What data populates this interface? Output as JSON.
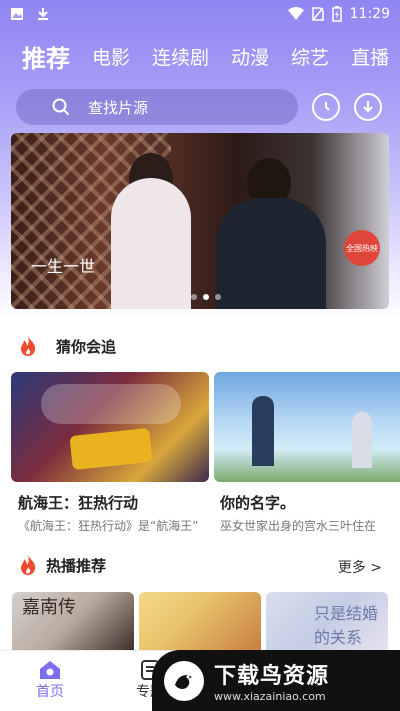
{
  "status_bar": {
    "time": "11:29",
    "icons": [
      "image-icon",
      "download-icon",
      "wifi-icon",
      "no-sim-icon",
      "battery-charging-icon"
    ]
  },
  "tabs": [
    {
      "label": "推荐",
      "active": true
    },
    {
      "label": "电影",
      "active": false
    },
    {
      "label": "连续剧",
      "active": false
    },
    {
      "label": "动漫",
      "active": false
    },
    {
      "label": "综艺",
      "active": false
    },
    {
      "label": "直播",
      "active": false
    }
  ],
  "search": {
    "placeholder": "查找片源"
  },
  "banner": {
    "calligraphy": "一生一世",
    "badge": "全国热映",
    "slides": 3,
    "current": 2
  },
  "guess_section": {
    "title": "猜你会追",
    "items": [
      {
        "title": "航海王：狂热行动",
        "desc": "《航海王：狂热行动》是“航海王”"
      },
      {
        "title": "你的名字。",
        "desc": "巫女世家出身的宫水三叶住在"
      }
    ]
  },
  "hot_section": {
    "title": "热播推荐",
    "more": "更多 >",
    "thumbs": [
      {
        "text": "嘉南传"
      },
      {
        "text": ""
      },
      {
        "text": "只是结婚的关系"
      }
    ]
  },
  "bottom_nav": [
    {
      "label": "首页",
      "active": true
    },
    {
      "label": "专题",
      "active": false
    }
  ],
  "watermark": {
    "title": "下载鸟资源",
    "url": "www.xiazainiao.com"
  },
  "colors": {
    "accent": "#7b6ff0",
    "header_top": "#8f86f2",
    "flame": "#f04a2f"
  }
}
